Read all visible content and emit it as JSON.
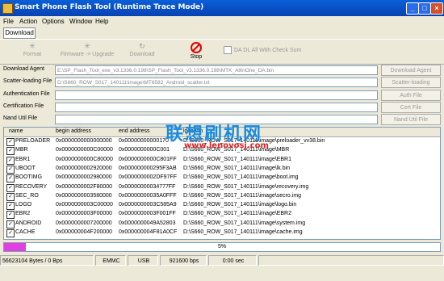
{
  "window": {
    "title": "Smart Phone Flash Tool (Runtime Trace Mode)"
  },
  "menu": [
    "File",
    "Action",
    "Options",
    "Window",
    "Help"
  ],
  "tab": "Download",
  "toolbar": {
    "format": "Format",
    "upgrade": "Firmware -> Upgrade",
    "download": "Download",
    "stop": "Stop",
    "checksum": "DA DL All With Check Sum"
  },
  "fields": [
    {
      "label": "Download Agent",
      "value": "E:\\SP_Flash_Tool_exe_v3.1336.0.198\\SP_Flash_Tool_v3.1336.0.198\\MTK_AllInOne_DA.bin",
      "button": "Download Agent"
    },
    {
      "label": "Scatter-loading File",
      "value": "D:\\S660_ROW_S017_140111\\image\\MT6582_Android_scatter.txt",
      "button": "Scatter-loading"
    },
    {
      "label": "Authentication File",
      "value": "",
      "button": "Auth File"
    },
    {
      "label": "Certification File",
      "value": "",
      "button": "Cert File"
    },
    {
      "label": "Nand Util File",
      "value": "",
      "button": "Nand Util File"
    }
  ],
  "table": {
    "headers": [
      "name",
      "begin address",
      "end address",
      "location"
    ],
    "rows": [
      {
        "name": "PRELOADER",
        "begin": "0x0000000000000000",
        "end": "0x00000000000170",
        "loc": "D:\\S660_ROW_S017_140111\\image\\preloader_vv38.bin"
      },
      {
        "name": "MBR",
        "begin": "0x0000000000C00000",
        "end": "0x0000000000C001",
        "loc": "D:\\S660_ROW_S017_140111\\image\\MBR"
      },
      {
        "name": "EBR1",
        "begin": "0x0000000000C80000",
        "end": "0x0000000000C801FF",
        "loc": "D:\\S660_ROW_S017_140111\\image\\EBR1"
      },
      {
        "name": "UBOOT",
        "begin": "0x0000000002920000",
        "end": "0x000000000295F3AB",
        "loc": "D:\\S660_ROW_S017_140111\\image\\lk.bin"
      },
      {
        "name": "BOOTIMG",
        "begin": "0x0000000002980000",
        "end": "0x0000000002DF97FF",
        "loc": "D:\\S660_ROW_S017_140111\\image\\boot.img"
      },
      {
        "name": "RECOVERY",
        "begin": "0x0000000002F80000",
        "end": "0x00000000034777FF",
        "loc": "D:\\S660_ROW_S017_140111\\image\\recovery.img"
      },
      {
        "name": "SEC_RO",
        "begin": "0x0000000003580000",
        "end": "0x00000000035A0FFF",
        "loc": "D:\\S660_ROW_S017_140111\\image\\secro.img"
      },
      {
        "name": "LOGO",
        "begin": "0x0000000003C00000",
        "end": "0x0000000003C585A9",
        "loc": "D:\\S660_ROW_S017_140111\\image\\logo.bin"
      },
      {
        "name": "EBR2",
        "begin": "0x0000000003F00000",
        "end": "0x0000000003F001FF",
        "loc": "D:\\S660_ROW_S017_140111\\image\\EBR2"
      },
      {
        "name": "ANDROID",
        "begin": "0x0000000007200000",
        "end": "0x0000000049A52803",
        "loc": "D:\\S660_ROW_S017_140111\\image\\system.img"
      },
      {
        "name": "CACHE",
        "begin": "0x000000004F200000",
        "end": "0x000000004F81A0CF",
        "loc": "D:\\S660_ROW_S017_140111\\image\\cache.img"
      }
    ]
  },
  "watermark": {
    "cn": "联想刷机网",
    "url": "www.lenovosj.com"
  },
  "progress": {
    "text": "5%",
    "fraction": 0.05,
    "color": "#E040E0"
  },
  "status": [
    "56623104 Bytes / 0 Bps",
    "EMMC",
    "USB",
    "921600 bps",
    "0:00 sec"
  ]
}
